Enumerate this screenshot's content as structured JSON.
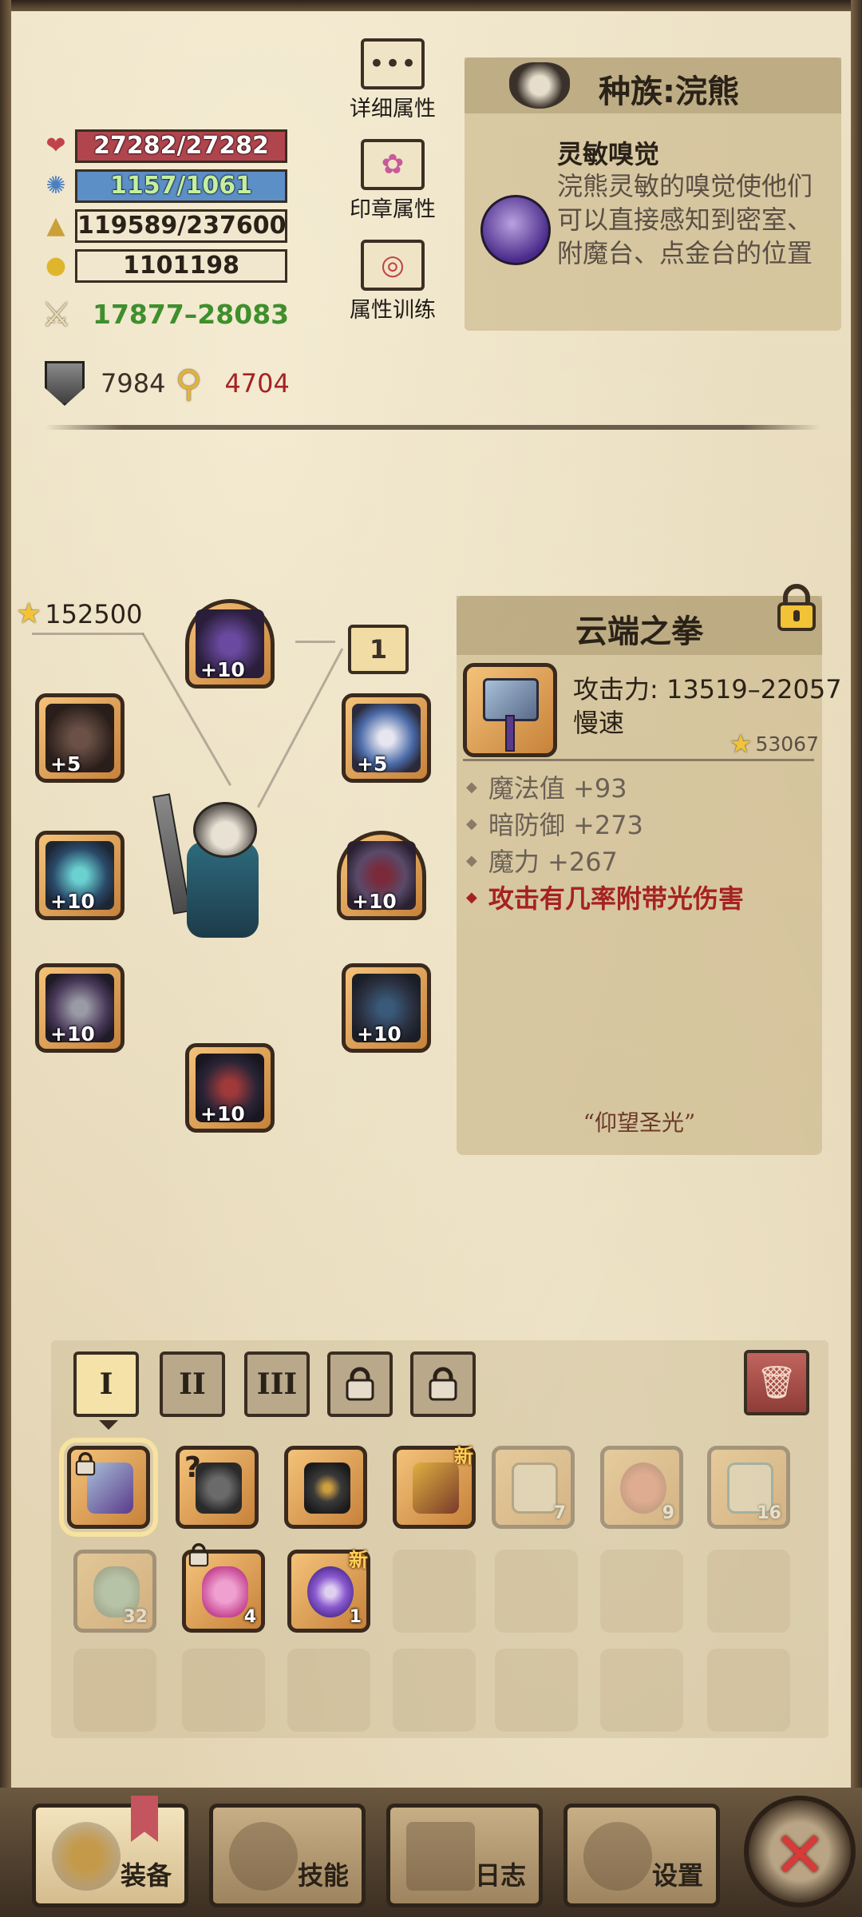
{
  "stats": {
    "hp": "27282/27282",
    "mp": "1157/1061",
    "exp": "119589/237600",
    "gold": "1101198",
    "attack": "17877–28083",
    "defense": "7984",
    "magic_defense": "4704"
  },
  "side_buttons": {
    "details": "详细属性",
    "seal": "印章属性",
    "training": "属性训练"
  },
  "race": {
    "title": "种族:浣熊",
    "skill_name": "灵敏嗅觉",
    "skill_desc": "浣熊灵敏的嗅觉使他们可以直接感知到密室、附魔台、点金台的位置"
  },
  "equipment": {
    "score": "152500",
    "page_number": "1",
    "slots": [
      {
        "name": "helmet",
        "level": "+10"
      },
      {
        "name": "amulet",
        "level": "+5"
      },
      {
        "name": "ring",
        "level": "+5"
      },
      {
        "name": "staff",
        "level": "+10"
      },
      {
        "name": "shoulder",
        "level": "+10"
      },
      {
        "name": "gauntlet",
        "level": "+10"
      },
      {
        "name": "armor",
        "level": "+10"
      },
      {
        "name": "boots",
        "level": "+10"
      }
    ]
  },
  "item_detail": {
    "title": "云端之拳",
    "attack": "攻击力: 13519–22057",
    "speed": "慢速",
    "score": "53067",
    "attrs": [
      "魔法值 +93",
      "暗防御 +273",
      "魔力 +267"
    ],
    "special": "攻击有几率附带光伤害",
    "motto": "“仰望圣光”"
  },
  "inventory": {
    "tabs": [
      "I",
      "II",
      "III"
    ],
    "items": [
      {
        "name": "fist-hammer",
        "qty": "",
        "new": false
      },
      {
        "name": "chain-helm",
        "qty": "",
        "new": false
      },
      {
        "name": "dark-helm",
        "qty": "",
        "new": false
      },
      {
        "name": "brush-staff",
        "qty": "",
        "new": true,
        "new_label": "新"
      },
      {
        "name": "scroll-a",
        "qty": "7",
        "new": false
      },
      {
        "name": "red-potion",
        "qty": "9",
        "new": false
      },
      {
        "name": "scroll-b",
        "qty": "16",
        "new": false
      },
      {
        "name": "green-potion",
        "qty": "32",
        "new": false
      },
      {
        "name": "pink-potion",
        "qty": "4",
        "new": false
      },
      {
        "name": "purple-potion",
        "qty": "1",
        "new": true,
        "new_label": "新"
      }
    ]
  },
  "nav": {
    "equipment": "装备",
    "skills": "技能",
    "log": "日志",
    "settings": "设置"
  },
  "colors": {
    "hp_bar": "#b1454e",
    "mp_bar": "#5d8fc7",
    "attack_text": "#3f8f2d",
    "magic_def_text": "#a52222",
    "special_attr": "#a52222"
  }
}
